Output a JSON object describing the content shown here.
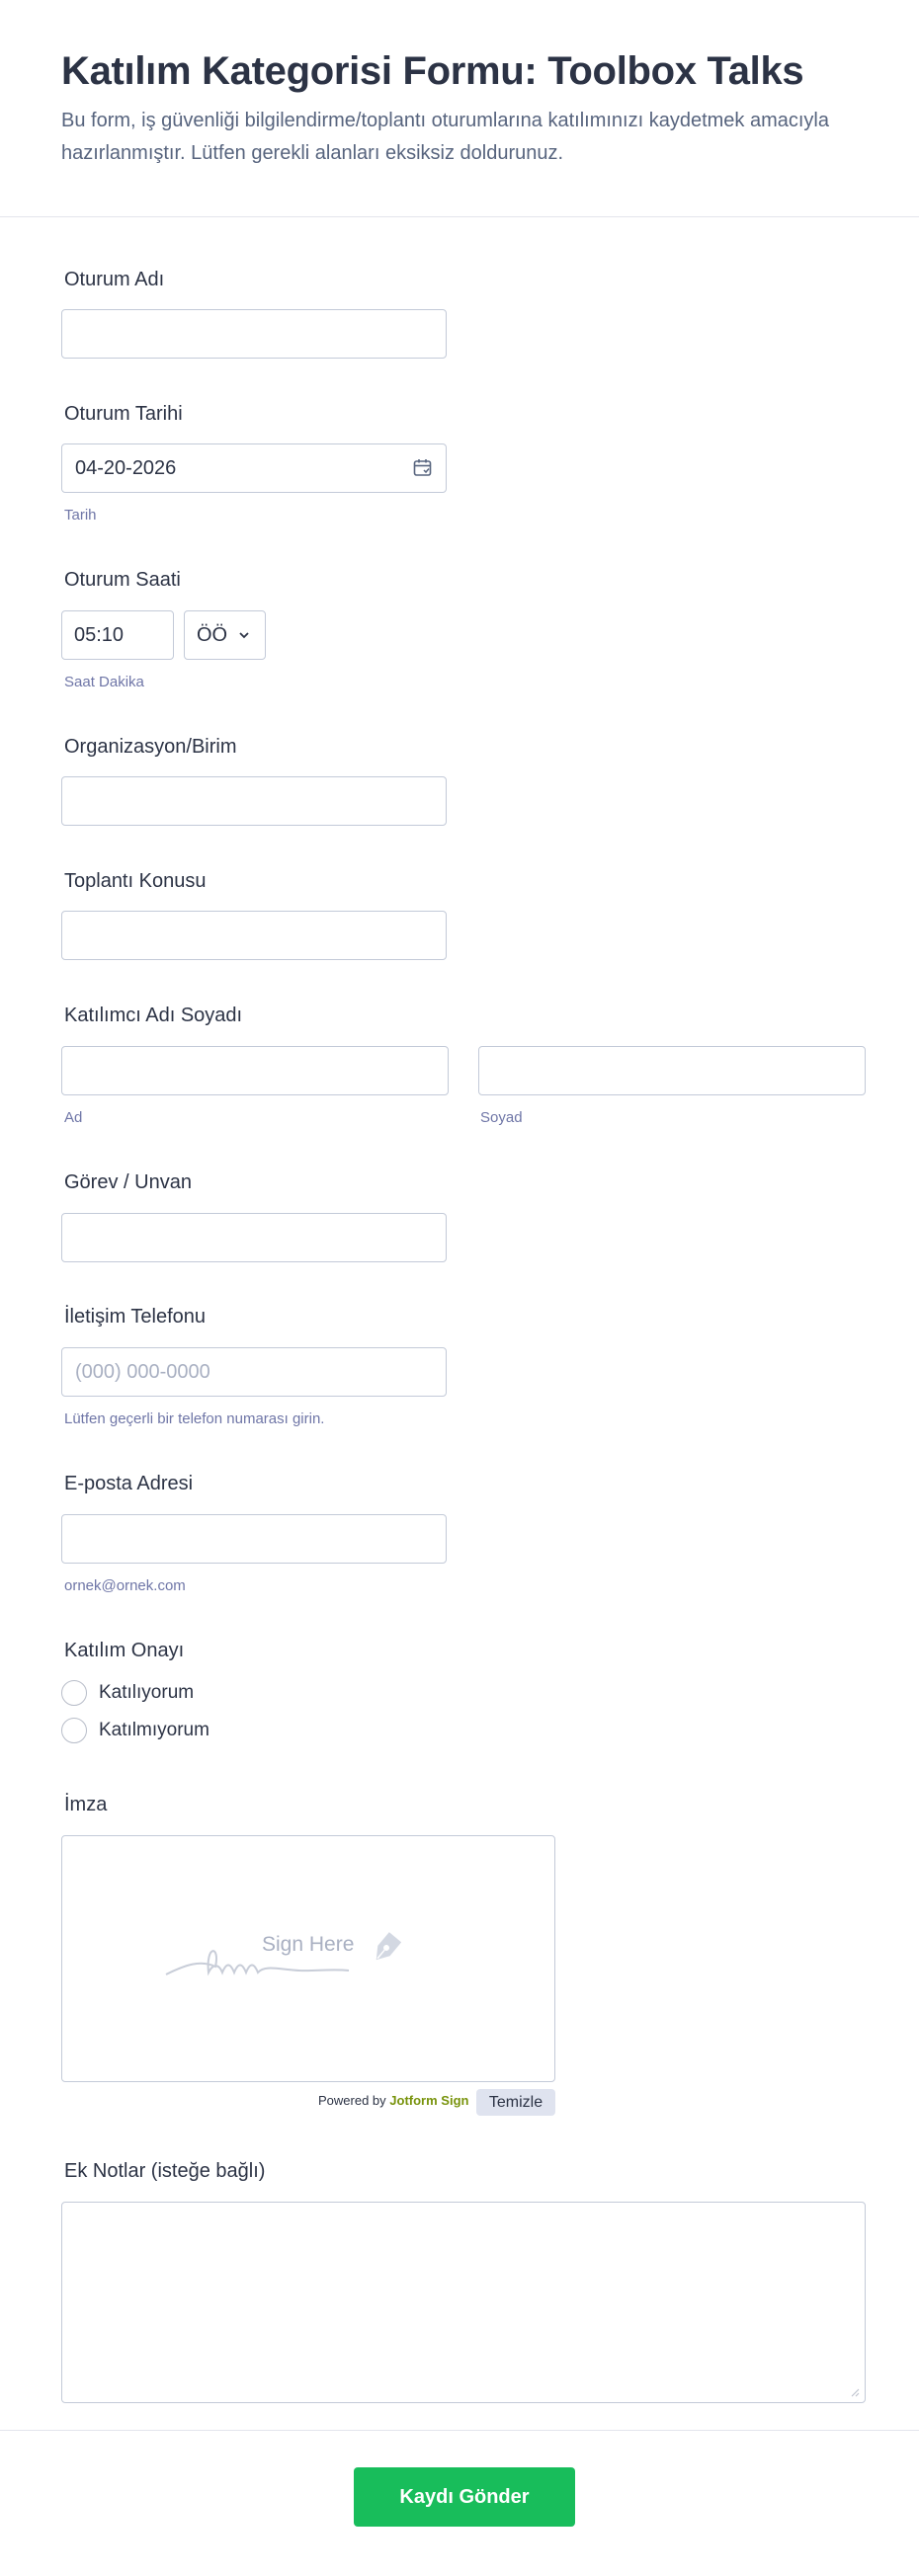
{
  "form": {
    "title": "Katılım Kategorisi Formu: Toolbox Talks",
    "subtitle": "Bu form, iş güvenliği bilgilendirme/toplantı oturumlarına katılımınızı kaydetmek amacıyla hazırlanmıştır. Lütfen gerekli alanları eksiksiz doldurunuz."
  },
  "fields": {
    "session_name": {
      "label": "Oturum Adı",
      "value": ""
    },
    "session_date": {
      "label": "Oturum Tarihi",
      "value": "04-20-2026",
      "sublabel": "Tarih",
      "icon": "calendar-icon"
    },
    "session_time": {
      "label": "Oturum Saati",
      "value": "05:10",
      "ampm": "ÖÖ",
      "sublabel": "Saat Dakika"
    },
    "organization": {
      "label": "Organizasyon/Birim",
      "value": ""
    },
    "topic": {
      "label": "Toplantı Konusu",
      "value": ""
    },
    "participant": {
      "label": "Katılımcı Adı Soyadı",
      "first_sublabel": "Ad",
      "last_sublabel": "Soyad"
    },
    "role": {
      "label": "Görev / Unvan",
      "value": ""
    },
    "phone": {
      "label": "İletişim Telefonu",
      "placeholder": "(000) 000-0000",
      "sublabel": "Lütfen geçerli bir telefon numarası girin."
    },
    "email": {
      "label": "E-posta Adresi",
      "value": "",
      "sublabel": "ornek@ornek.com"
    },
    "consent": {
      "label": "Katılım Onayı",
      "options": [
        "Katılıyorum",
        "Katılmıyorum"
      ]
    },
    "signature": {
      "label": "İmza",
      "hint": "Sign Here",
      "powered_prefix": "Powered by",
      "powered_brand": "Jotform Sign",
      "clear_label": "Temizle"
    },
    "notes": {
      "label": "Ek Notlar (isteğe bağlı)"
    }
  },
  "submit": {
    "label": "Kaydı Gönder"
  },
  "colors": {
    "accent": "#18bd5b",
    "text": "#2c3345",
    "subtext": "#57647e",
    "border": "#c3cad8",
    "brand": "#78930c"
  }
}
